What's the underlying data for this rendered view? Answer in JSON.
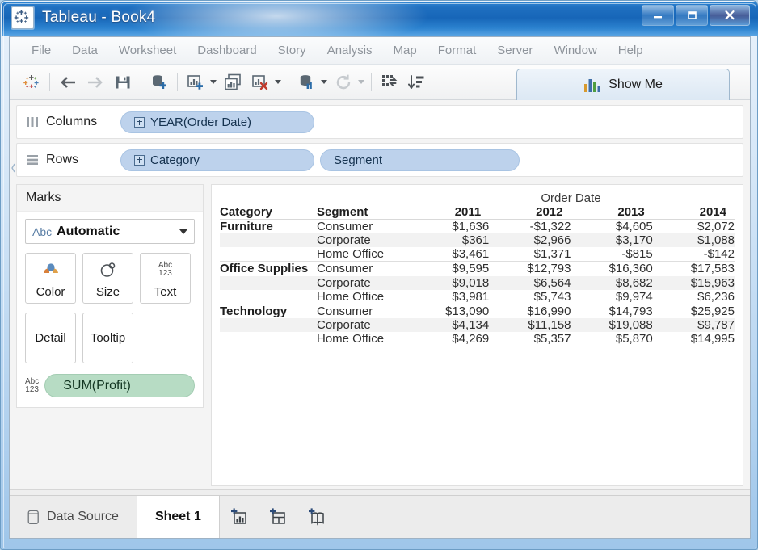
{
  "window": {
    "title": "Tableau - Book4",
    "app_icon": "tableau-logo-icon",
    "minimize_label": "—",
    "maximize_label": "□",
    "close_label": "✕"
  },
  "menubar": {
    "items": [
      {
        "label": "File"
      },
      {
        "label": "Data"
      },
      {
        "label": "Worksheet"
      },
      {
        "label": "Dashboard"
      },
      {
        "label": "Story"
      },
      {
        "label": "Analysis"
      },
      {
        "label": "Map"
      },
      {
        "label": "Format"
      },
      {
        "label": "Server"
      },
      {
        "label": "Window"
      },
      {
        "label": "Help"
      }
    ]
  },
  "toolbar": {
    "show_me_label": "Show Me",
    "buttons": [
      {
        "name": "tableau-home-icon"
      },
      {
        "name": "back-arrow-icon"
      },
      {
        "name": "forward-arrow-icon"
      },
      {
        "name": "save-icon"
      },
      {
        "name": "new-data-source-icon"
      },
      {
        "name": "new-worksheet-icon"
      },
      {
        "name": "duplicate-sheet-icon"
      },
      {
        "name": "clear-sheet-icon"
      },
      {
        "name": "refresh-data-source-icon"
      },
      {
        "name": "refresh-icon"
      },
      {
        "name": "swap-rows-columns-icon"
      },
      {
        "name": "sort-descending-icon"
      }
    ]
  },
  "shelves": {
    "columns": {
      "label": "Columns",
      "icon": "columns-icon",
      "pills": [
        {
          "label": "YEAR(Order Date)",
          "has_expand": true
        }
      ]
    },
    "rows": {
      "label": "Rows",
      "icon": "rows-icon",
      "pills": [
        {
          "label": "Category",
          "has_expand": true
        },
        {
          "label": "Segment",
          "has_expand": false
        }
      ]
    }
  },
  "marks": {
    "title": "Marks",
    "mark_type": {
      "prefix": "Abc",
      "value": "Automatic"
    },
    "buttons": [
      {
        "label": "Color",
        "icon": "color-palette-icon"
      },
      {
        "label": "Size",
        "icon": "size-circle-icon"
      },
      {
        "label": "Text",
        "icon": "abc123-icon"
      },
      {
        "label": "Detail",
        "icon": "detail-icon"
      },
      {
        "label": "Tooltip",
        "icon": "tooltip-icon"
      }
    ],
    "text_pill": {
      "icon_top": "Abc",
      "icon_bottom": "123",
      "label": "SUM(Profit)"
    }
  },
  "crosstab": {
    "column_group_header": "Order Date",
    "headers": [
      "Category",
      "Segment",
      "2011",
      "2012",
      "2013",
      "2014"
    ],
    "rows": [
      {
        "category": "Furniture",
        "segment": "Consumer",
        "values": [
          "$1,636",
          "-$1,322",
          "$4,605",
          "$2,072"
        ]
      },
      {
        "category": "",
        "segment": "Corporate",
        "values": [
          "$361",
          "$2,966",
          "$3,170",
          "$1,088"
        ]
      },
      {
        "category": "",
        "segment": "Home Office",
        "values": [
          "$3,461",
          "$1,371",
          "-$815",
          "-$142"
        ]
      },
      {
        "category": "Office Supplies",
        "segment": "Consumer",
        "values": [
          "$9,595",
          "$12,793",
          "$16,360",
          "$17,583"
        ]
      },
      {
        "category": "",
        "segment": "Corporate",
        "values": [
          "$9,018",
          "$6,564",
          "$8,682",
          "$15,963"
        ]
      },
      {
        "category": "",
        "segment": "Home Office",
        "values": [
          "$3,981",
          "$5,743",
          "$9,974",
          "$6,236"
        ]
      },
      {
        "category": "Technology",
        "segment": "Consumer",
        "values": [
          "$13,090",
          "$16,990",
          "$14,793",
          "$25,925"
        ]
      },
      {
        "category": "",
        "segment": "Corporate",
        "values": [
          "$4,134",
          "$11,158",
          "$19,088",
          "$9,787"
        ]
      },
      {
        "category": "",
        "segment": "Home Office",
        "values": [
          "$4,269",
          "$5,357",
          "$5,870",
          "$14,995"
        ]
      }
    ]
  },
  "statusbar": {
    "data_source_tab": {
      "label": "Data Source",
      "icon": "database-icon"
    },
    "sheet_tabs": [
      {
        "label": "Sheet 1",
        "active": true
      }
    ],
    "new_buttons": [
      {
        "name": "new-worksheet-icon"
      },
      {
        "name": "new-dashboard-icon"
      },
      {
        "name": "new-story-icon"
      }
    ]
  },
  "colors": {
    "title_blue": "#1f6fc0",
    "pill_blue": "#bdd2ec",
    "pill_green": "#b7dcc4",
    "menu_text": "#8e949b"
  }
}
